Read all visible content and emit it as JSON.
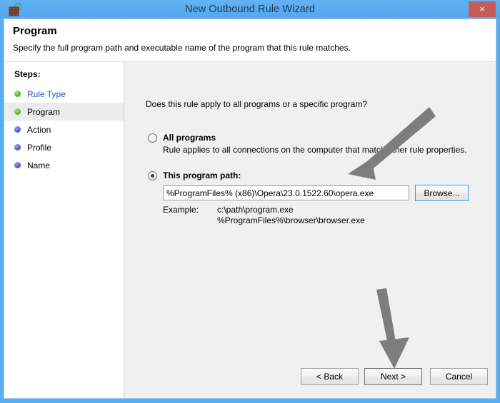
{
  "window": {
    "title": "New Outbound Rule Wizard",
    "icon": "firewall-icon",
    "close_label": "×",
    "titlebar_color": "#59abf0",
    "accent_color": "#3c9bdc"
  },
  "header": {
    "title": "Program",
    "subtitle": "Specify the full program path and executable name of the program that this rule matches."
  },
  "sidebar": {
    "heading": "Steps:",
    "items": [
      {
        "label": "Rule Type",
        "state": "done",
        "link": true,
        "current": false
      },
      {
        "label": "Program",
        "state": "done",
        "link": false,
        "current": true
      },
      {
        "label": "Action",
        "state": "pending",
        "link": false,
        "current": false
      },
      {
        "label": "Profile",
        "state": "pending",
        "link": false,
        "current": false
      },
      {
        "label": "Name",
        "state": "pending",
        "link": false,
        "current": false
      }
    ]
  },
  "main": {
    "question": "Does this rule apply to all programs or a specific program?",
    "option_all": {
      "label": "All programs",
      "description": "Rule applies to all connections on the computer that match other rule properties.",
      "selected": false
    },
    "option_path": {
      "label": "This program path:",
      "selected": true
    },
    "path_field": {
      "value": "%ProgramFiles% (x86)\\Opera\\23.0.1522.60\\opera.exe",
      "placeholder": ""
    },
    "browse_label": "Browse...",
    "example": {
      "label": "Example:",
      "lines": [
        "c:\\path\\program.exe",
        "%ProgramFiles%\\browser\\browser.exe"
      ]
    }
  },
  "footer": {
    "back_label": "< Back",
    "next_label": "Next >",
    "cancel_label": "Cancel"
  },
  "annotations": [
    {
      "name": "arrow-to-path-field",
      "color": "#7d7d7d"
    },
    {
      "name": "arrow-to-next-button",
      "color": "#7d7d7d"
    }
  ]
}
